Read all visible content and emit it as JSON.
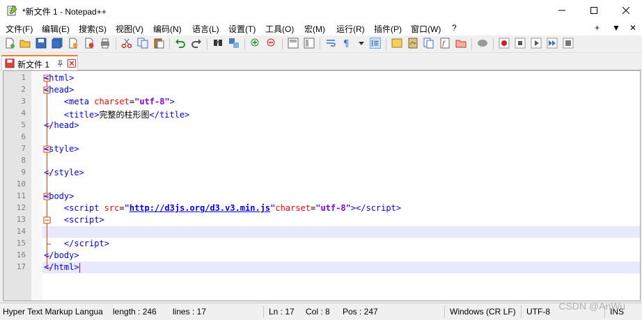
{
  "window": {
    "title": "*新文件 1 - Notepad++"
  },
  "menu": {
    "items": [
      "文件(F)",
      "编辑(E)",
      "搜索(S)",
      "视图(V)",
      "编码(N)",
      "语言(L)",
      "设置(T)",
      "工具(O)",
      "宏(M)",
      "运行(R)",
      "插件(P)",
      "窗口(W)",
      "?"
    ],
    "right": [
      "+",
      "▼",
      "✕"
    ]
  },
  "tab": {
    "label": "新文件 1"
  },
  "editor": {
    "line_numbers": [
      "1",
      "2",
      "3",
      "4",
      "5",
      "6",
      "7",
      "8",
      "9",
      "10",
      "11",
      "12",
      "13",
      "14",
      "15",
      "16",
      "17"
    ],
    "current_line": 17,
    "title_text": "完整的柱形图",
    "script_src": "http://d3js.org/d3.v3.min.js",
    "charset": "utf-8"
  },
  "status": {
    "language": "Hyper Text Markup Langua",
    "length": "length : 246",
    "lines": "lines : 17",
    "ln": "Ln : 17",
    "col": "Col : 8",
    "pos": "Pos : 247",
    "eol": "Windows (CR LF)",
    "encoding": "UTF-8",
    "mode": "INS"
  },
  "watermark": "CSDN @AnWu",
  "colors": {
    "tag": "#0000ff",
    "attribute": "#ff0000",
    "value": "#8000ff",
    "tab_accent": "#f08030",
    "fold_marker": "#e04000"
  }
}
